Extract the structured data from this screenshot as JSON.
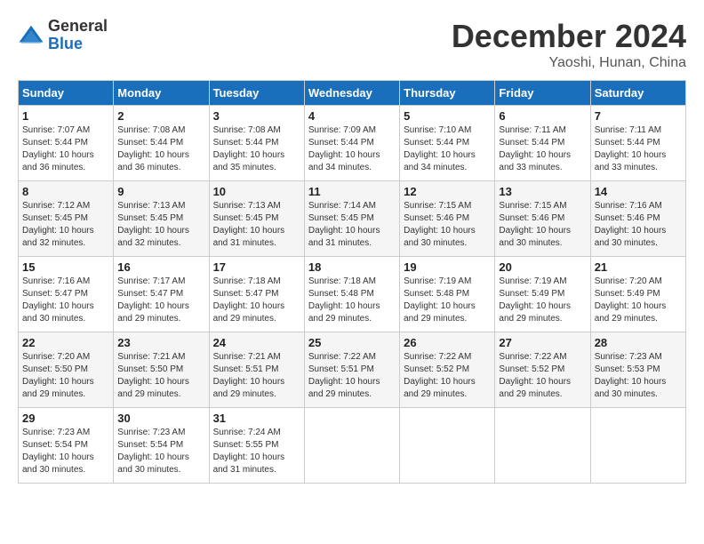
{
  "logo": {
    "general": "General",
    "blue": "Blue"
  },
  "title": "December 2024",
  "location": "Yaoshi, Hunan, China",
  "weekdays": [
    "Sunday",
    "Monday",
    "Tuesday",
    "Wednesday",
    "Thursday",
    "Friday",
    "Saturday"
  ],
  "weeks": [
    [
      {
        "day": "1",
        "sunrise": "7:07 AM",
        "sunset": "5:44 PM",
        "daylight": "10 hours and 36 minutes."
      },
      {
        "day": "2",
        "sunrise": "7:08 AM",
        "sunset": "5:44 PM",
        "daylight": "10 hours and 36 minutes."
      },
      {
        "day": "3",
        "sunrise": "7:08 AM",
        "sunset": "5:44 PM",
        "daylight": "10 hours and 35 minutes."
      },
      {
        "day": "4",
        "sunrise": "7:09 AM",
        "sunset": "5:44 PM",
        "daylight": "10 hours and 34 minutes."
      },
      {
        "day": "5",
        "sunrise": "7:10 AM",
        "sunset": "5:44 PM",
        "daylight": "10 hours and 34 minutes."
      },
      {
        "day": "6",
        "sunrise": "7:11 AM",
        "sunset": "5:44 PM",
        "daylight": "10 hours and 33 minutes."
      },
      {
        "day": "7",
        "sunrise": "7:11 AM",
        "sunset": "5:44 PM",
        "daylight": "10 hours and 33 minutes."
      }
    ],
    [
      {
        "day": "8",
        "sunrise": "7:12 AM",
        "sunset": "5:45 PM",
        "daylight": "10 hours and 32 minutes."
      },
      {
        "day": "9",
        "sunrise": "7:13 AM",
        "sunset": "5:45 PM",
        "daylight": "10 hours and 32 minutes."
      },
      {
        "day": "10",
        "sunrise": "7:13 AM",
        "sunset": "5:45 PM",
        "daylight": "10 hours and 31 minutes."
      },
      {
        "day": "11",
        "sunrise": "7:14 AM",
        "sunset": "5:45 PM",
        "daylight": "10 hours and 31 minutes."
      },
      {
        "day": "12",
        "sunrise": "7:15 AM",
        "sunset": "5:46 PM",
        "daylight": "10 hours and 30 minutes."
      },
      {
        "day": "13",
        "sunrise": "7:15 AM",
        "sunset": "5:46 PM",
        "daylight": "10 hours and 30 minutes."
      },
      {
        "day": "14",
        "sunrise": "7:16 AM",
        "sunset": "5:46 PM",
        "daylight": "10 hours and 30 minutes."
      }
    ],
    [
      {
        "day": "15",
        "sunrise": "7:16 AM",
        "sunset": "5:47 PM",
        "daylight": "10 hours and 30 minutes."
      },
      {
        "day": "16",
        "sunrise": "7:17 AM",
        "sunset": "5:47 PM",
        "daylight": "10 hours and 29 minutes."
      },
      {
        "day": "17",
        "sunrise": "7:18 AM",
        "sunset": "5:47 PM",
        "daylight": "10 hours and 29 minutes."
      },
      {
        "day": "18",
        "sunrise": "7:18 AM",
        "sunset": "5:48 PM",
        "daylight": "10 hours and 29 minutes."
      },
      {
        "day": "19",
        "sunrise": "7:19 AM",
        "sunset": "5:48 PM",
        "daylight": "10 hours and 29 minutes."
      },
      {
        "day": "20",
        "sunrise": "7:19 AM",
        "sunset": "5:49 PM",
        "daylight": "10 hours and 29 minutes."
      },
      {
        "day": "21",
        "sunrise": "7:20 AM",
        "sunset": "5:49 PM",
        "daylight": "10 hours and 29 minutes."
      }
    ],
    [
      {
        "day": "22",
        "sunrise": "7:20 AM",
        "sunset": "5:50 PM",
        "daylight": "10 hours and 29 minutes."
      },
      {
        "day": "23",
        "sunrise": "7:21 AM",
        "sunset": "5:50 PM",
        "daylight": "10 hours and 29 minutes."
      },
      {
        "day": "24",
        "sunrise": "7:21 AM",
        "sunset": "5:51 PM",
        "daylight": "10 hours and 29 minutes."
      },
      {
        "day": "25",
        "sunrise": "7:22 AM",
        "sunset": "5:51 PM",
        "daylight": "10 hours and 29 minutes."
      },
      {
        "day": "26",
        "sunrise": "7:22 AM",
        "sunset": "5:52 PM",
        "daylight": "10 hours and 29 minutes."
      },
      {
        "day": "27",
        "sunrise": "7:22 AM",
        "sunset": "5:52 PM",
        "daylight": "10 hours and 29 minutes."
      },
      {
        "day": "28",
        "sunrise": "7:23 AM",
        "sunset": "5:53 PM",
        "daylight": "10 hours and 30 minutes."
      }
    ],
    [
      {
        "day": "29",
        "sunrise": "7:23 AM",
        "sunset": "5:54 PM",
        "daylight": "10 hours and 30 minutes."
      },
      {
        "day": "30",
        "sunrise": "7:23 AM",
        "sunset": "5:54 PM",
        "daylight": "10 hours and 30 minutes."
      },
      {
        "day": "31",
        "sunrise": "7:24 AM",
        "sunset": "5:55 PM",
        "daylight": "10 hours and 31 minutes."
      },
      null,
      null,
      null,
      null
    ]
  ]
}
